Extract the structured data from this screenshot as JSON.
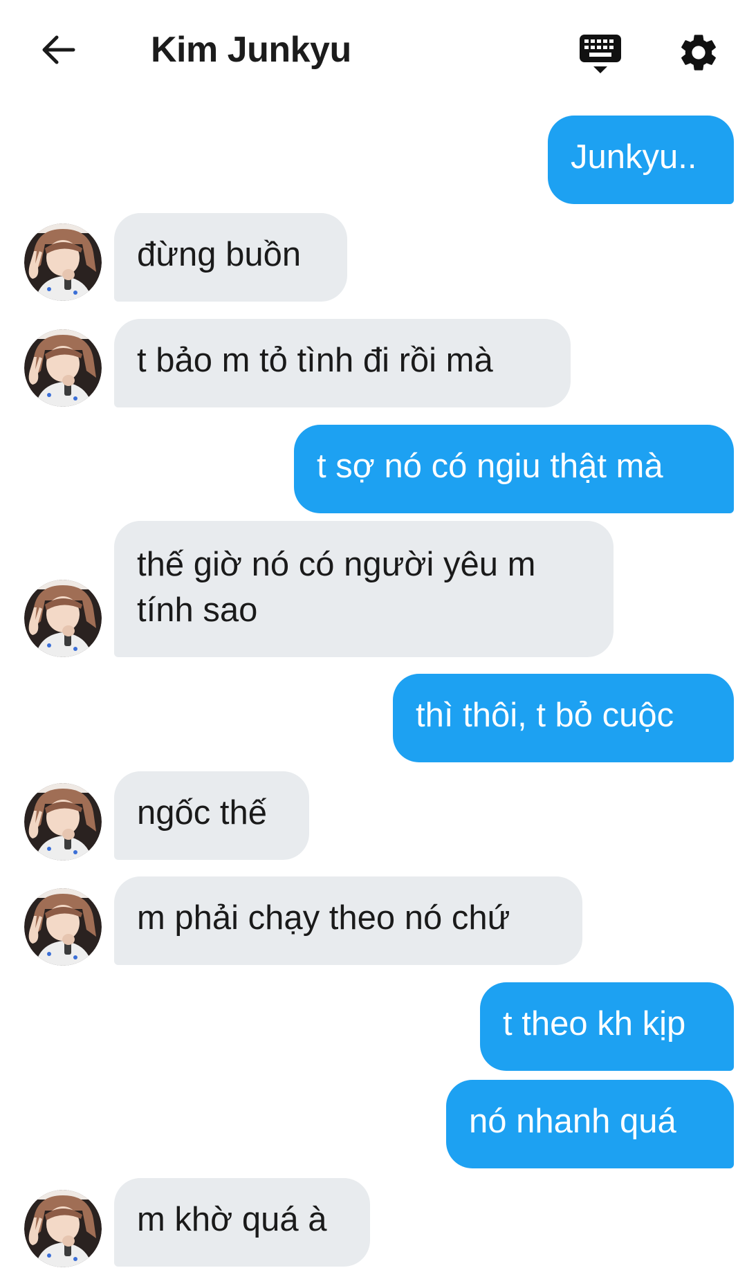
{
  "header": {
    "title": "Kim Junkyu",
    "back_icon": "arrow-left-icon",
    "keyboard_icon": "keyboard-icon",
    "settings_icon": "gear-icon"
  },
  "colors": {
    "sent_bubble": "#1da1f2",
    "received_bubble": "#e8ebee"
  },
  "messages": [
    {
      "from": "me",
      "text": "Junkyu.."
    },
    {
      "from": "them",
      "text": "đừng buồn"
    },
    {
      "from": "them",
      "text": "t bảo m tỏ tình đi rồi mà"
    },
    {
      "from": "me",
      "text": "t sợ nó có ngiu thật mà"
    },
    {
      "from": "them",
      "text": "thế giờ nó có người yêu m tính sao"
    },
    {
      "from": "me",
      "text": "thì thôi, t bỏ cuộc"
    },
    {
      "from": "them",
      "text": "ngốc thế"
    },
    {
      "from": "them",
      "text": "m phải chạy theo nó chứ"
    },
    {
      "from": "me",
      "text": "t theo kh kịp"
    },
    {
      "from": "me",
      "text": "nó nhanh quá"
    },
    {
      "from": "them",
      "text": "m khờ quá à"
    }
  ]
}
